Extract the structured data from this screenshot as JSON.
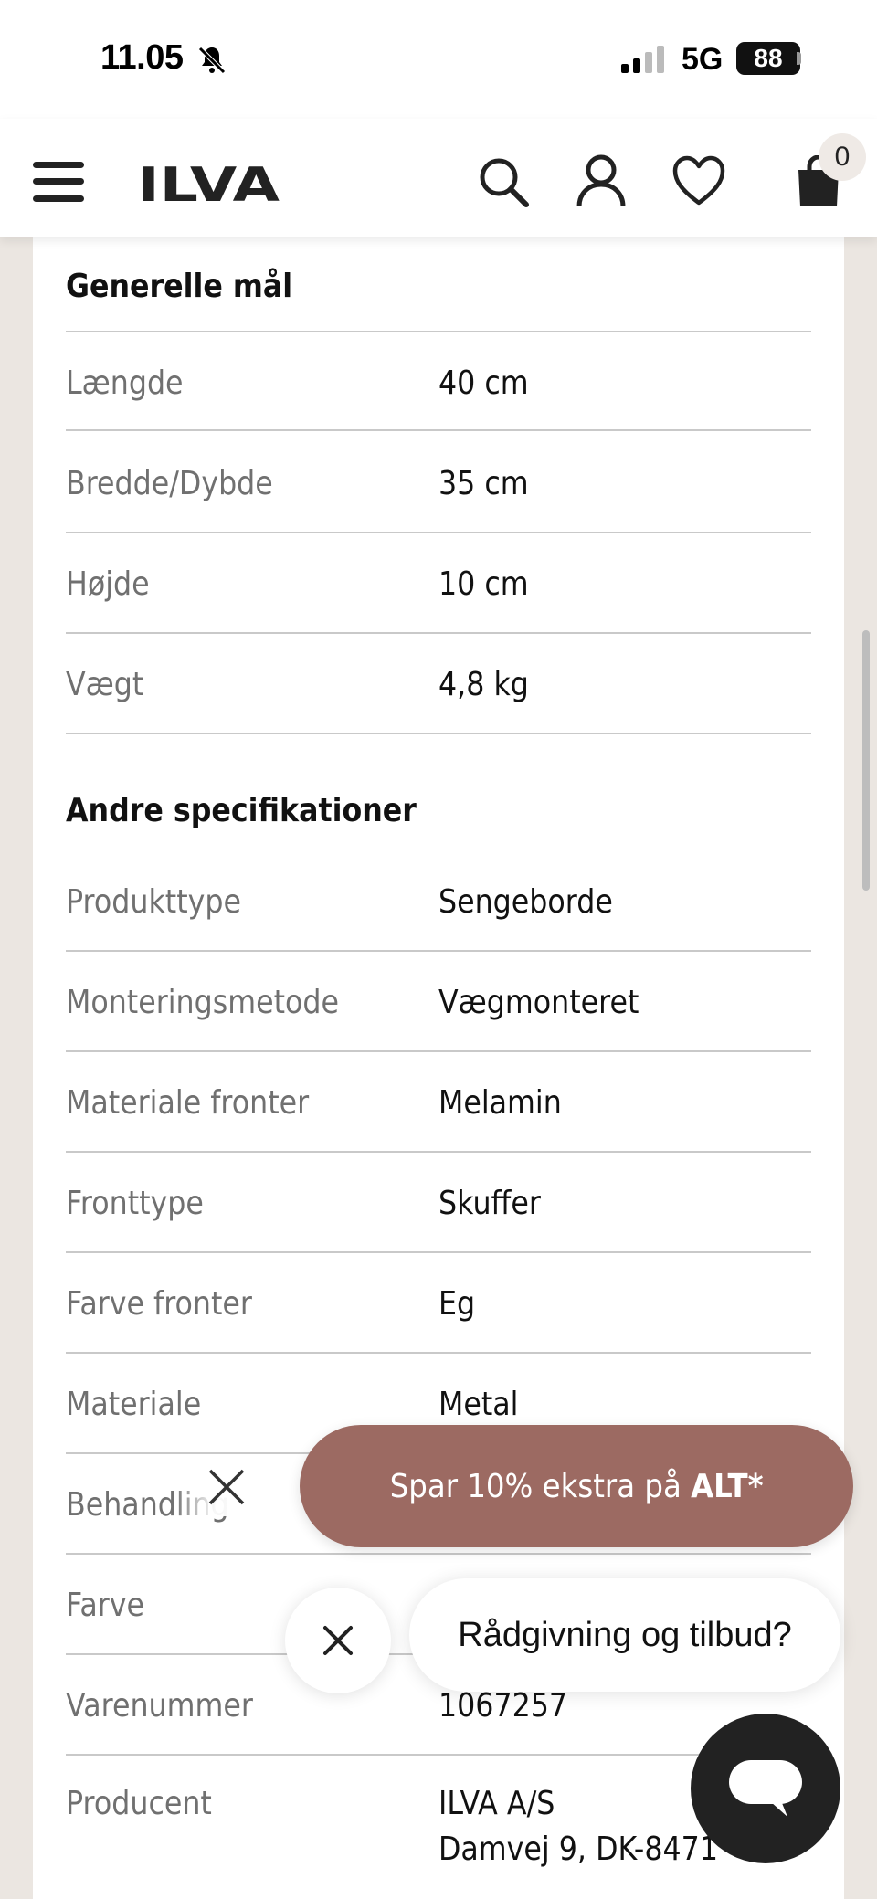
{
  "status_bar": {
    "time": "11.05",
    "network": "5G",
    "battery": "88"
  },
  "header": {
    "logo_text": "ILVA",
    "cart_count": "0",
    "icons": [
      "menu-icon",
      "search-icon",
      "user-icon",
      "heart-icon",
      "cart-icon"
    ]
  },
  "general": {
    "title": "Generelle mål",
    "rows": [
      {
        "label": "Længde",
        "value": "40 cm"
      },
      {
        "label": "Bredde/Dybde",
        "value": "35 cm"
      },
      {
        "label": "Højde",
        "value": "10 cm"
      },
      {
        "label": "Vægt",
        "value": "4,8 kg"
      }
    ]
  },
  "other": {
    "title": "Andre specifikationer",
    "rows": [
      {
        "label": "Produkttype",
        "value": "Sengeborde"
      },
      {
        "label": "Monteringsmetode",
        "value": "Vægmonteret"
      },
      {
        "label": "Materiale fronter",
        "value": "Melamin"
      },
      {
        "label": "Fronttype",
        "value": "Skuffer"
      },
      {
        "label": "Farve fronter",
        "value": "Eg"
      },
      {
        "label": "Materiale",
        "value": "Metal"
      },
      {
        "label": "Behandling",
        "value": ""
      },
      {
        "label": "Farve",
        "value": ""
      },
      {
        "label": "Varenummer",
        "value": "1067257"
      },
      {
        "label": "Producent",
        "value_line1": "ILVA A/S",
        "value_line2": "Damvej 9, DK-8471"
      }
    ]
  },
  "promo": {
    "text_prefix": "Spar 10% ekstra på ",
    "text_bold": "ALT*",
    "color": "#9c6a62"
  },
  "chat": {
    "prompt": "Rådgivning og tilbud?",
    "button_color": "#222222"
  }
}
